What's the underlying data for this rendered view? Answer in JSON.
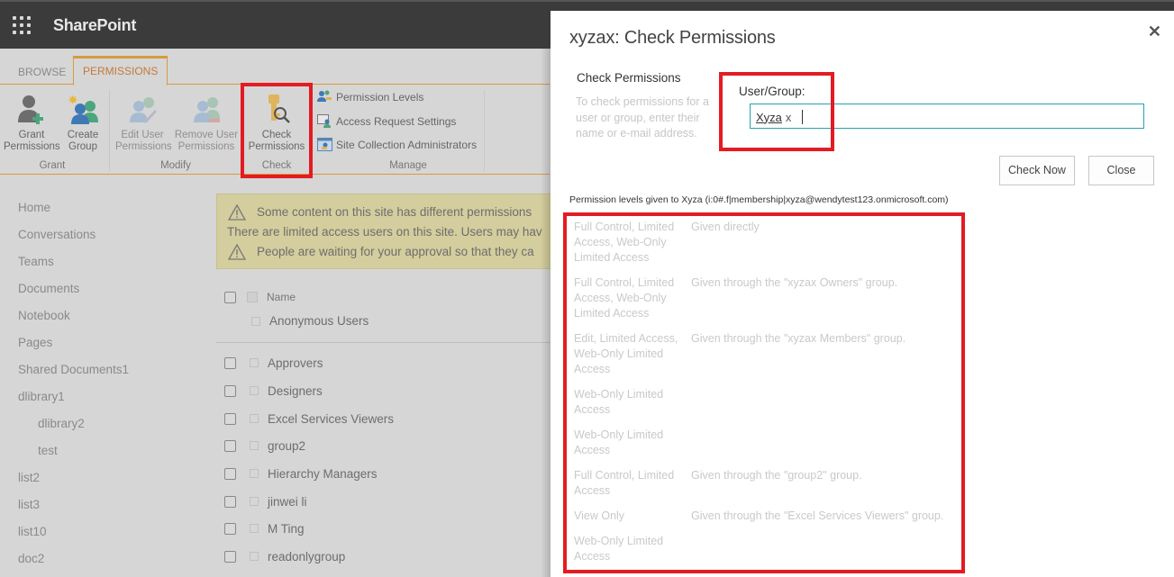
{
  "suitebar": {
    "app_name": "SharePoint",
    "app_launcher_icon": "waffle-icon"
  },
  "ribbon": {
    "tabs": [
      {
        "label": "BROWSE",
        "active": false
      },
      {
        "label": "PERMISSIONS",
        "active": true
      }
    ],
    "groups": {
      "grant": {
        "label": "Grant",
        "buttons": [
          {
            "label_line1": "Grant",
            "label_line2": "Permissions",
            "icon": "grant-permissions-icon"
          },
          {
            "label_line1": "Create",
            "label_line2": "Group",
            "icon": "create-group-icon"
          }
        ]
      },
      "modify": {
        "label": "Modify",
        "buttons": [
          {
            "label_line1": "Edit User",
            "label_line2": "Permissions",
            "icon": "edit-user-permissions-icon",
            "disabled": true
          },
          {
            "label_line1": "Remove User",
            "label_line2": "Permissions",
            "icon": "remove-user-permissions-icon",
            "disabled": true
          }
        ]
      },
      "check": {
        "label": "Check",
        "buttons": [
          {
            "label_line1": "Check",
            "label_line2": "Permissions",
            "icon": "key-search-icon"
          }
        ]
      },
      "manage": {
        "label": "Manage",
        "buttons": [
          {
            "label": "Permission Levels",
            "icon": "permission-levels-icon"
          },
          {
            "label": "Access Request Settings",
            "icon": "access-request-icon"
          },
          {
            "label": "Site Collection Administrators",
            "icon": "site-admins-icon"
          }
        ]
      }
    }
  },
  "leftnav": {
    "items": [
      {
        "label": "Home",
        "sub": false
      },
      {
        "label": "Conversations",
        "sub": false
      },
      {
        "label": "Teams",
        "sub": false
      },
      {
        "label": "Documents",
        "sub": false
      },
      {
        "label": "Notebook",
        "sub": false
      },
      {
        "label": "Pages",
        "sub": false
      },
      {
        "label": "Shared Documents1",
        "sub": false
      },
      {
        "label": "dlibrary1",
        "sub": false
      },
      {
        "label": "dlibrary2",
        "sub": true
      },
      {
        "label": "test",
        "sub": true
      },
      {
        "label": "list2",
        "sub": false
      },
      {
        "label": "list3",
        "sub": false
      },
      {
        "label": "list10",
        "sub": false
      },
      {
        "label": "doc2",
        "sub": false
      }
    ]
  },
  "warnings": {
    "line1": "Some content on this site has different permissions",
    "line2": "There are limited access users on this site. Users may hav",
    "line3": "People are waiting for your approval so that they ca"
  },
  "grouplist": {
    "column_header": "Name",
    "anonymous": "Anonymous Users",
    "rows": [
      "Approvers",
      "Designers",
      "Excel Services Viewers",
      "group2",
      "Hierarchy Managers",
      "jinwei li",
      "M Ting",
      "readonlygroup"
    ]
  },
  "dialog": {
    "title": "xyzax: Check Permissions",
    "close_symbol": "✕",
    "section_title": "Check Permissions",
    "section_desc": "To check permissions for a user or group, enter their name or e-mail address.",
    "user_group_label": "User/Group:",
    "user_token": "Xyza",
    "token_remove": "x",
    "check_now_label": "Check Now",
    "close_label": "Close",
    "result_heading": "Permission levels given to Xyza (i:0#.f|membership|xyza@wendytest123.onmicrosoft.com)",
    "results": [
      {
        "levels": "Full Control, Limited Access, Web-Only Limited Access",
        "source": "Given directly"
      },
      {
        "levels": "Full Control, Limited Access, Web-Only Limited Access",
        "source": "Given through the \"xyzax Owners\" group."
      },
      {
        "levels": "Edit, Limited Access, Web-Only Limited Access",
        "source": "Given through the \"xyzax Members\" group."
      },
      {
        "levels": "Web-Only Limited Access",
        "source": ""
      },
      {
        "levels": "Web-Only Limited Access",
        "source": ""
      },
      {
        "levels": "Full Control, Limited Access",
        "source": "Given through the \"group2\" group."
      },
      {
        "levels": "View Only",
        "source": "Given through the \"Excel Services Viewers\" group."
      },
      {
        "levels": "Web-Only Limited Access",
        "source": ""
      }
    ]
  },
  "colors": {
    "highlight": "#e31b23",
    "accent_tab": "#d79b3e",
    "input_border": "#26a3b0",
    "suitebar": "#3b3b3b"
  }
}
